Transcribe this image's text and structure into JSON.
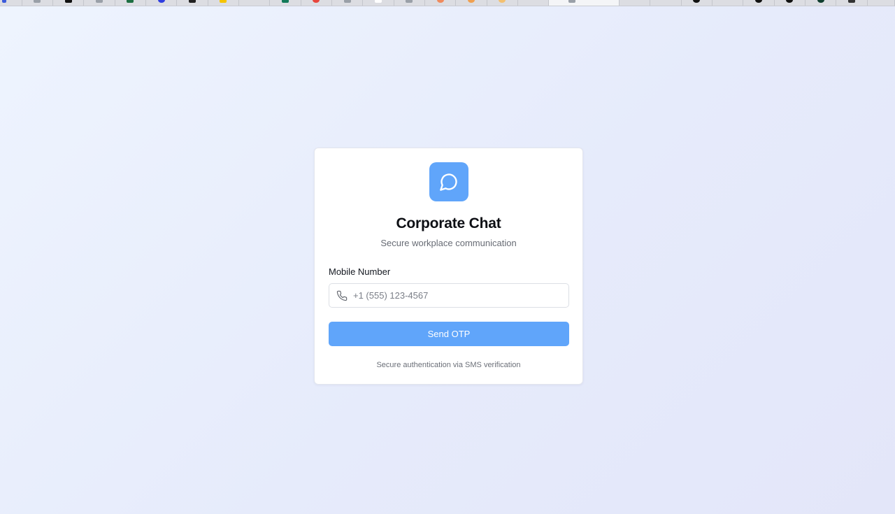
{
  "app": {
    "title": "Corporate Chat",
    "subtitle": "Secure workplace communication",
    "logo_icon": "chat-bubble-icon",
    "accent_color": "#60a5fa"
  },
  "form": {
    "phone_label": "Mobile Number",
    "phone_icon": "phone-icon",
    "phone_value": "",
    "phone_placeholder": "+1 (555) 123-4567",
    "submit_label": "Send OTP"
  },
  "footer": {
    "note": "Secure authentication via SMS verification"
  }
}
